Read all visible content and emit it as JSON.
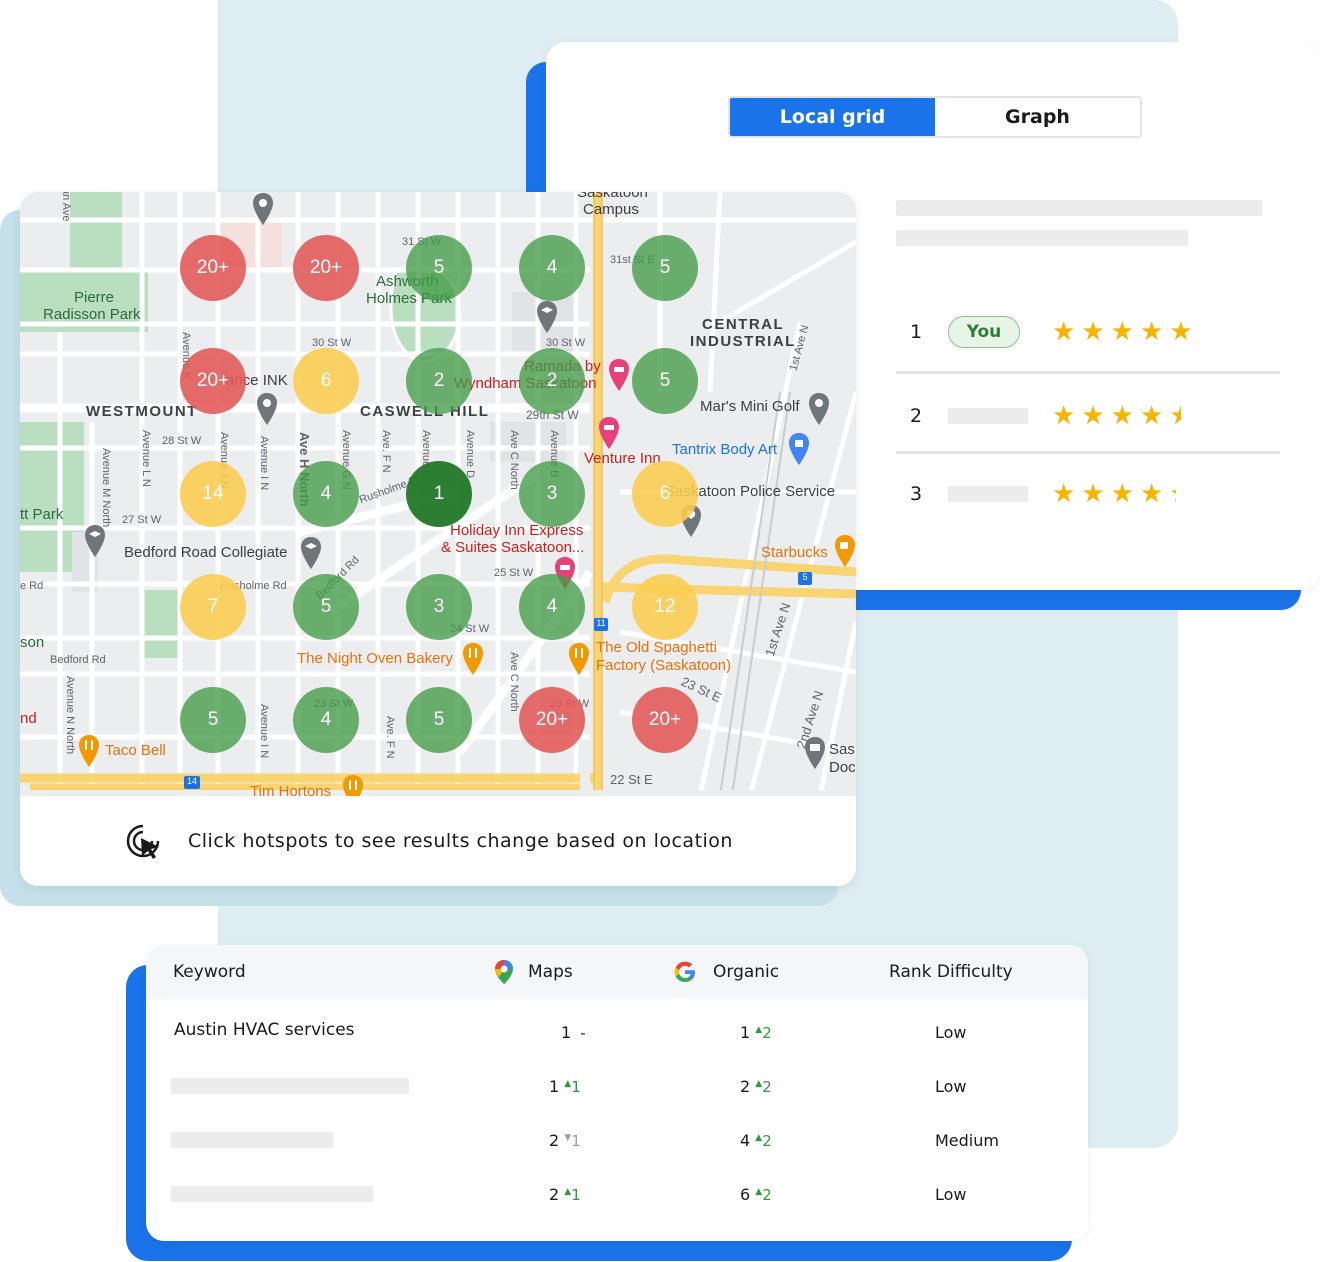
{
  "toggle": {
    "local_grid": "Local grid",
    "graph": "Graph"
  },
  "rankings": [
    {
      "rank": "1",
      "badge": "You",
      "rating": 5
    },
    {
      "rank": "2",
      "badge": "",
      "rating": 4.5
    },
    {
      "rank": "3",
      "badge": "",
      "rating": 4.3
    }
  ],
  "map": {
    "districts": {
      "central_industrial_1": "CENTRAL",
      "central_industrial_2": "INDUSTRIAL",
      "westmount": "WESTMOUNT",
      "caswell_hill": "CASWELL HILL"
    },
    "parks": {
      "pierre_1": "Pierre",
      "pierre_2": "Radisson Park",
      "ashworth_1": "Ashworth",
      "ashworth_2": "Holmes Park",
      "tt_park": "tt Park",
      "son": "son",
      "nd": "nd"
    },
    "pois": {
      "saskatoon_campus_1": "Saskatoon",
      "saskatoon_campus_2": "Campus",
      "ramada_1": "Ramada by",
      "ramada_2": "Wyndham Saskatoon",
      "mars_mini_golf": "Mar's Mini Golf",
      "venture_inn": "Venture Inn",
      "tantrix": "Tantrix Body Art",
      "police": "Saskatoon Police Service",
      "holiday_inn_1": "Holiday Inn Express",
      "holiday_inn_2": "& Suites Saskatoon...",
      "starbucks": "Starbucks",
      "bedford_collegiate": "Bedford Road Collegiate",
      "night_oven": "The Night Oven Bakery",
      "old_spaghetti_1": "The Old Spaghetti",
      "old_spaghetti_2": "Factory (Saskatoon)",
      "taco_bell": "Taco Bell",
      "tim_hortons": "Tim Hortons",
      "sas_1": "Sas",
      "sas_2": "Doc",
      "ance_ink": "ance INK"
    },
    "streets": {
      "s31": "31 St W",
      "s30": "30 St W",
      "s29": "29th St W",
      "s28": "28 St W",
      "s27": "27 St W",
      "s25": "25 St W",
      "s24": "24 St W",
      "s23": "23 St W",
      "s22e": "22 St E",
      "s23e": "23 St E",
      "s31e": "31st St E",
      "rusholme_rd": "Rusholme Rd",
      "rusholme_pl": "Rusholme Pl",
      "bedford_rd": "Bedford Rd",
      "bedford_rd2": "Bedford Rd",
      "b_rd": "e Rd",
      "ave_h": "Ave H North",
      "ave_c": "Ave C North",
      "ave_c2": "Ave C North",
      "first_ave": "1st Ave N",
      "first_ave2": "1st Ave N",
      "second_ave": "2nd Ave N",
      "ave_m": "Avenue M North",
      "ave_l": "Avenue L N",
      "ave_i": "Avenue I N",
      "ave_i2": "Avenue I N",
      "ave_j": "Avenue J N",
      "ave_g": "Avenue G N",
      "ave_f": "Ave. F N",
      "ave_f2": "Ave. F N",
      "ave_e": "Avenue E",
      "ave_d": "Avenue D",
      "ave_b": "Avenue B",
      "ave_n": "Avenue N North",
      "ave_k": "Avenue K",
      "ave_an": "an Ave",
      "hwy_11": "11",
      "hwy_14": "14",
      "hwy_5": "5"
    },
    "hotspots": [
      {
        "label": "20+",
        "color": "red"
      },
      {
        "label": "20+",
        "color": "red"
      },
      {
        "label": "5",
        "color": "green"
      },
      {
        "label": "4",
        "color": "green"
      },
      {
        "label": "5",
        "color": "green"
      },
      {
        "label": "20+",
        "color": "red"
      },
      {
        "label": "6",
        "color": "yellow"
      },
      {
        "label": "2",
        "color": "green"
      },
      {
        "label": "2",
        "color": "green"
      },
      {
        "label": "5",
        "color": "green"
      },
      {
        "label": "14",
        "color": "yellow"
      },
      {
        "label": "4",
        "color": "green"
      },
      {
        "label": "1",
        "color": "darkgreen"
      },
      {
        "label": "3",
        "color": "green"
      },
      {
        "label": "6",
        "color": "yellow"
      },
      {
        "label": "7",
        "color": "yellow"
      },
      {
        "label": "5",
        "color": "green"
      },
      {
        "label": "3",
        "color": "green"
      },
      {
        "label": "4",
        "color": "green"
      },
      {
        "label": "12",
        "color": "yellow"
      },
      {
        "label": "5",
        "color": "green"
      },
      {
        "label": "4",
        "color": "green"
      },
      {
        "label": "5",
        "color": "green"
      },
      {
        "label": "20+",
        "color": "red"
      },
      {
        "label": "20+",
        "color": "red"
      }
    ],
    "footer_text": "Click hotspots to see results change based on location"
  },
  "table": {
    "headers": {
      "keyword": "Keyword",
      "maps": "Maps",
      "organic": "Organic",
      "rank_difficulty": "Rank Difficulty"
    },
    "rows": [
      {
        "keyword": "Austin HVAC services",
        "maps": "1",
        "maps_delta": "-",
        "maps_dir": "none",
        "organic": "1",
        "organic_delta": "2",
        "organic_dir": "up",
        "difficulty": "Low"
      },
      {
        "keyword": "",
        "maps": "1",
        "maps_delta": "1",
        "maps_dir": "up",
        "organic": "2",
        "organic_delta": "2",
        "organic_dir": "up",
        "difficulty": "Low"
      },
      {
        "keyword": "",
        "maps": "2",
        "maps_delta": "1",
        "maps_dir": "down",
        "organic": "4",
        "organic_delta": "2",
        "organic_dir": "up",
        "difficulty": "Medium"
      },
      {
        "keyword": "",
        "maps": "2",
        "maps_delta": "1",
        "maps_dir": "up",
        "organic": "6",
        "organic_delta": "2",
        "organic_dir": "up",
        "difficulty": "Low"
      }
    ]
  },
  "colors": {
    "accent": "#1a73e8",
    "red": "#e25757",
    "yellow": "#facd50",
    "green": "#439b46",
    "dark_green": "#227828",
    "star": "#f7b400"
  }
}
